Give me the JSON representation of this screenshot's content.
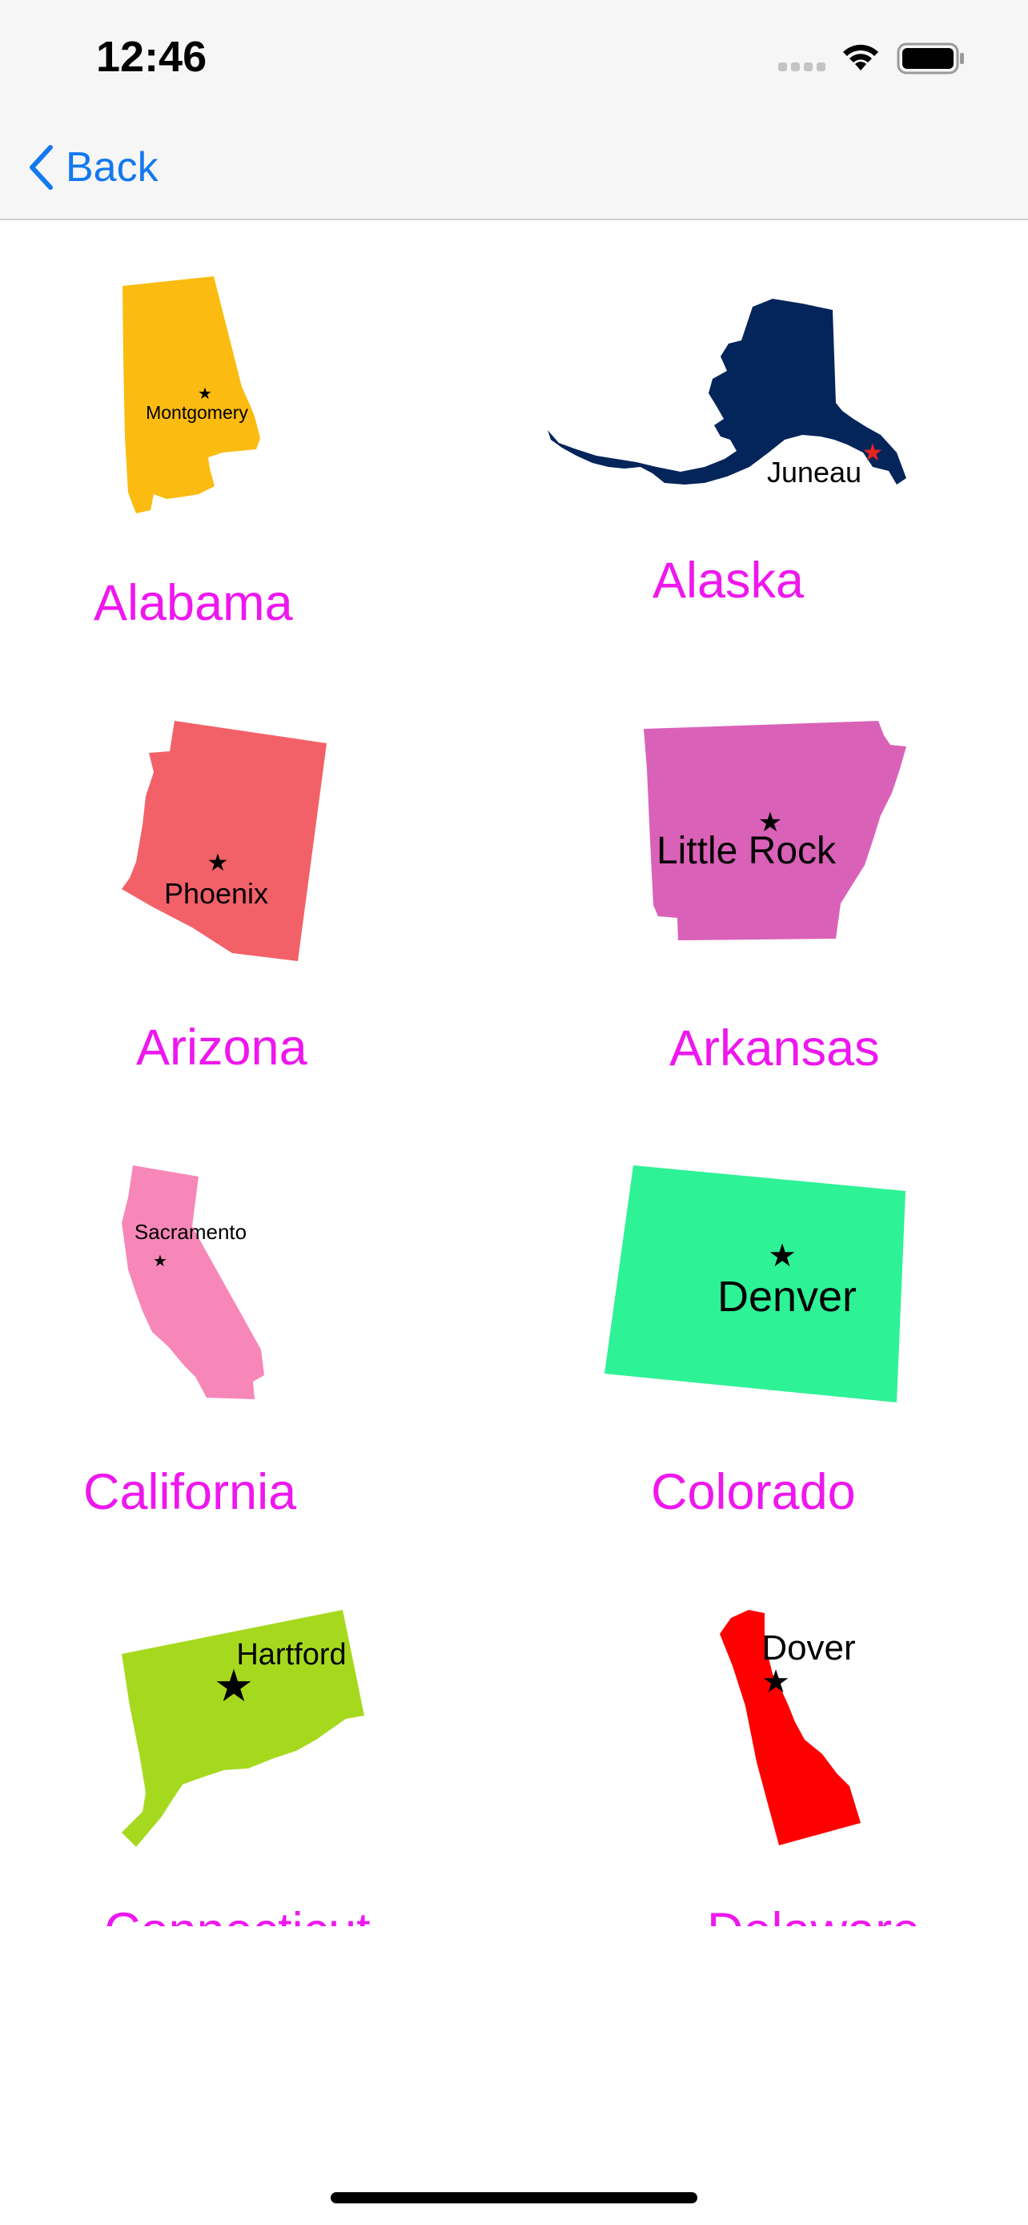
{
  "status_bar": {
    "time": "12:46"
  },
  "nav": {
    "back_label": "Back"
  },
  "states": [
    {
      "name": "Alabama",
      "capital": "Montgomery",
      "color": "#fbbb10"
    },
    {
      "name": "Alaska",
      "capital": "Juneau",
      "color": "#04255a"
    },
    {
      "name": "Arizona",
      "capital": "Phoenix",
      "color": "#f36168"
    },
    {
      "name": "Arkansas",
      "capital": "Little Rock",
      "color": "#da61b8"
    },
    {
      "name": "California",
      "capital": "Sacramento",
      "color": "#f787b8"
    },
    {
      "name": "Colorado",
      "capital": "Denver",
      "color": "#2ef296"
    },
    {
      "name": "Connecticut",
      "capital": "Hartford",
      "color": "#a6d91e"
    },
    {
      "name": "Delaware",
      "capital": "Dover",
      "color": "#ff0000"
    }
  ],
  "colors": {
    "accent": "#1478ef",
    "label": "#ee17ee",
    "capital_star_alaska": "#e8241f"
  }
}
